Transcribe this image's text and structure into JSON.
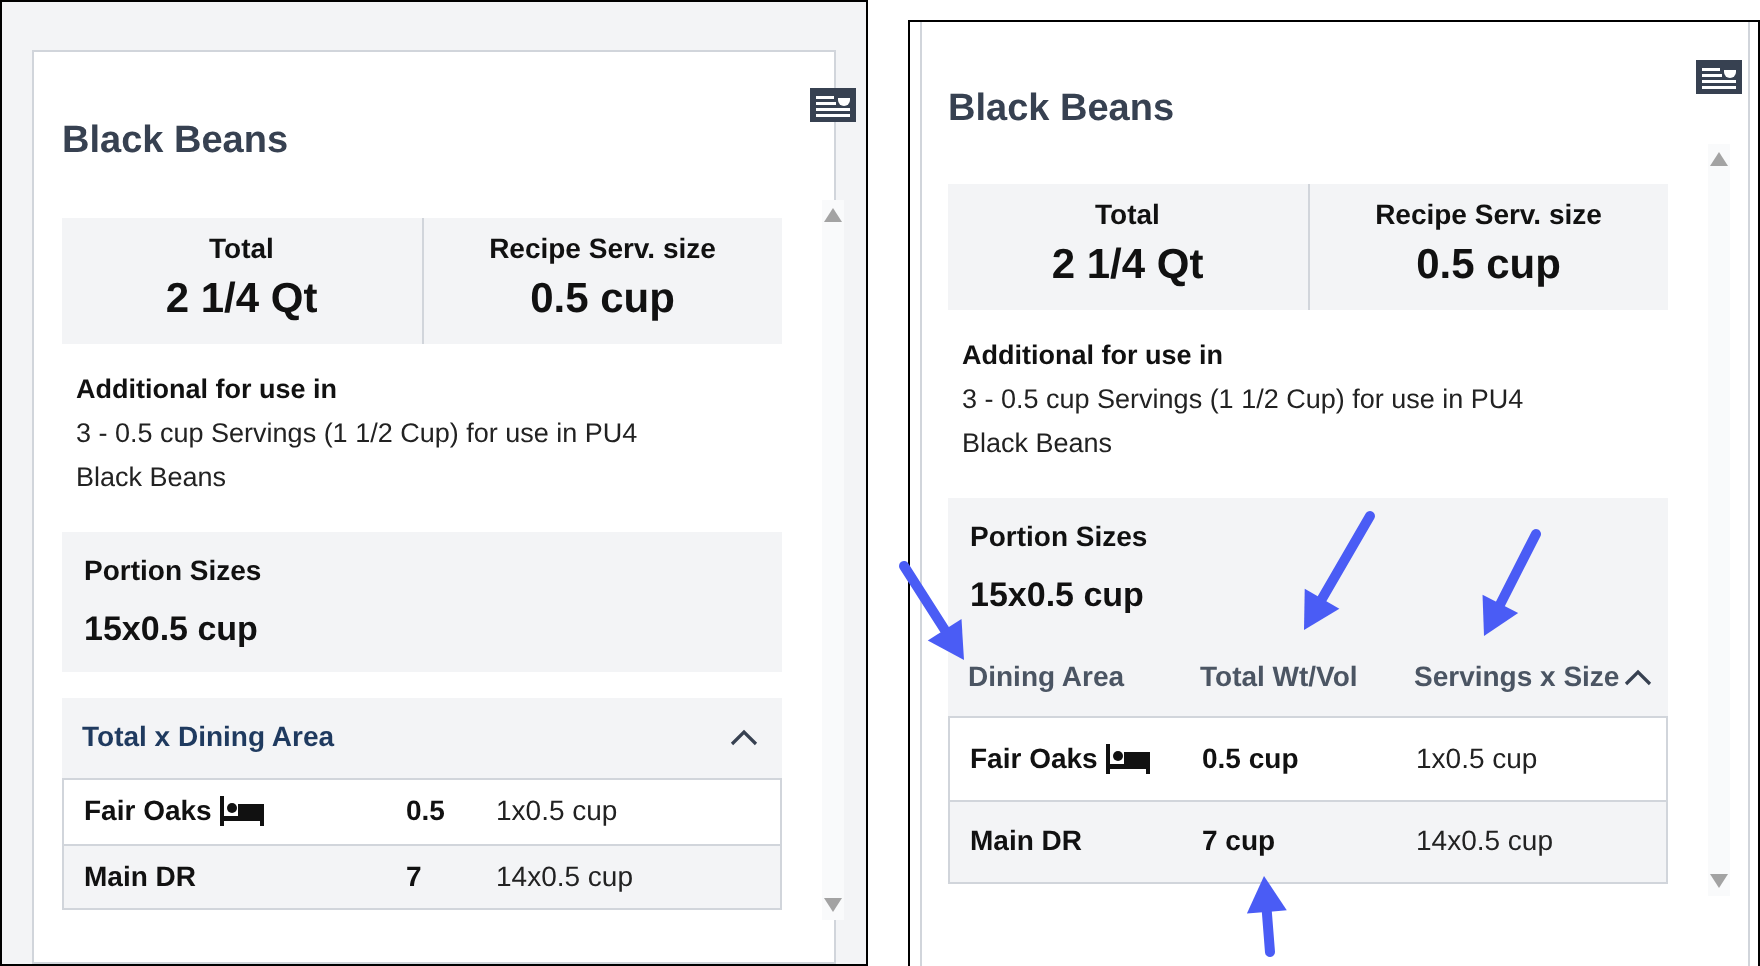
{
  "panels": [
    {
      "title": "Black Beans",
      "summary": [
        {
          "label": "Total",
          "value": "2 1/4 Qt"
        },
        {
          "label": "Recipe Serv. size",
          "value": "0.5 cup"
        }
      ],
      "additional": {
        "label": "Additional for use in",
        "text": "3 - 0.5 cup Servings (1 1/2 Cup) for use in PU4 Black Beans"
      },
      "portion": {
        "label": "Portion Sizes",
        "value": "15x0.5 cup"
      },
      "dining": {
        "kind": "titled",
        "title": "Total x Dining Area",
        "expanded": true,
        "rows": [
          {
            "area": "Fair Oaks",
            "lodging": true,
            "total": "0.5",
            "servings": "1x0.5 cup"
          },
          {
            "area": "Main DR",
            "lodging": false,
            "total": "7",
            "servings": "14x0.5 cup"
          }
        ]
      }
    },
    {
      "title": "Black Beans",
      "summary": [
        {
          "label": "Total",
          "value": "2 1/4 Qt"
        },
        {
          "label": "Recipe Serv. size",
          "value": "0.5 cup"
        }
      ],
      "additional": {
        "label": "Additional for use in",
        "text": "3 - 0.5 cup Servings (1 1/2 Cup) for use in PU4 Black Beans"
      },
      "portion": {
        "label": "Portion Sizes",
        "value": "15x0.5 cup"
      },
      "dining": {
        "kind": "columns",
        "columns": [
          "Dining Area",
          "Total Wt/Vol",
          "Servings x Size"
        ],
        "expanded": true,
        "rows": [
          {
            "area": "Fair Oaks",
            "lodging": true,
            "total": "0.5 cup",
            "servings": "1x0.5 cup"
          },
          {
            "area": "Main DR",
            "lodging": false,
            "total": "7 cup",
            "servings": "14x0.5 cup"
          }
        ]
      }
    }
  ]
}
